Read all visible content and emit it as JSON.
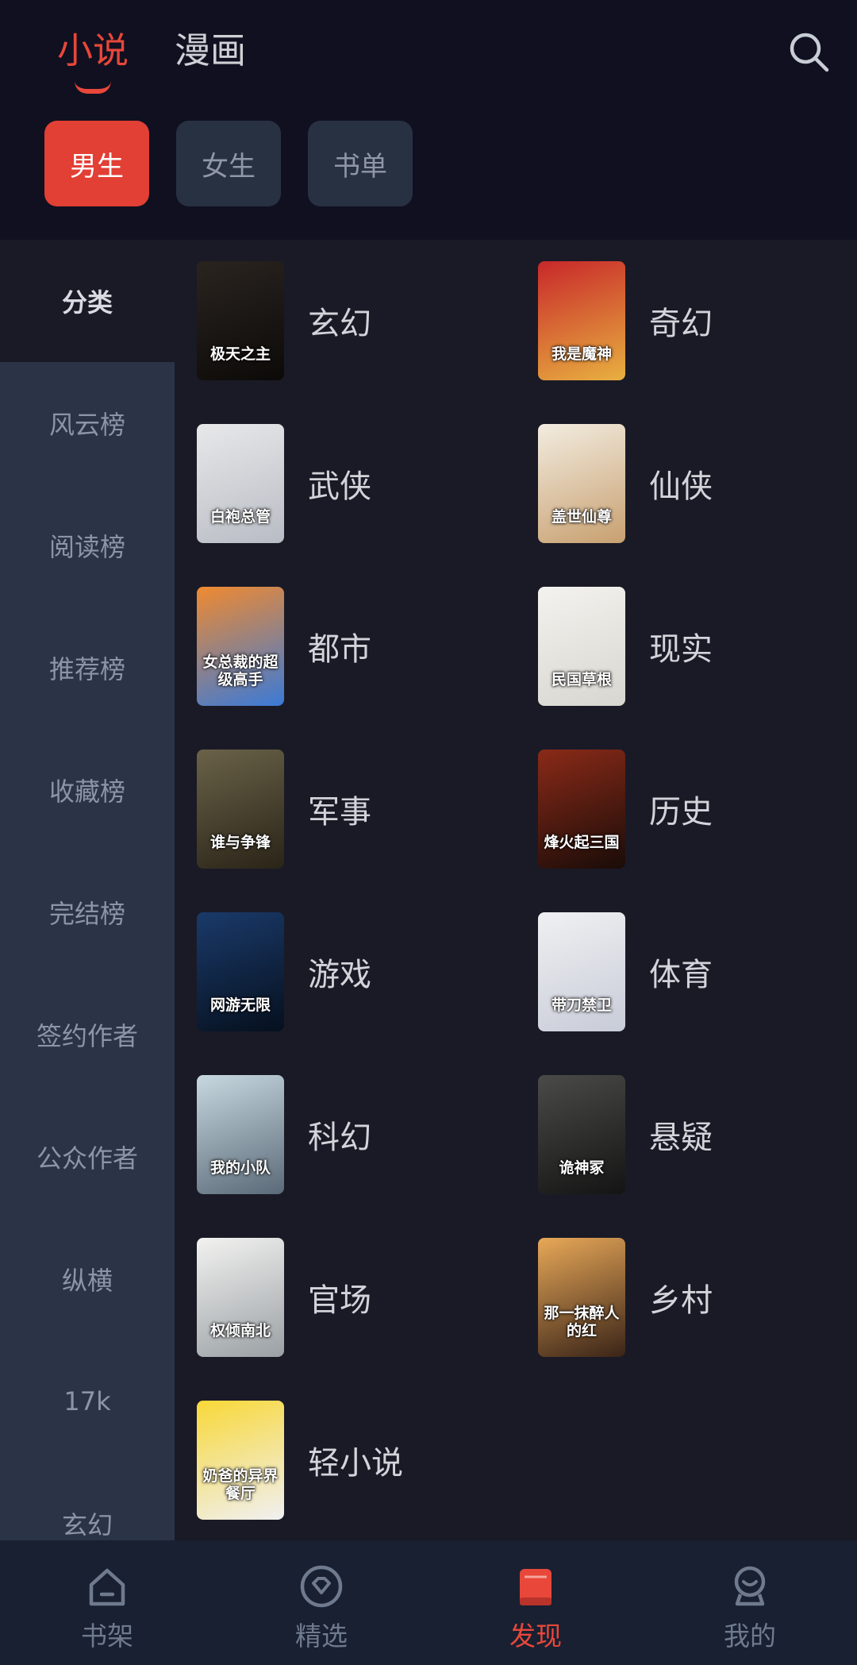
{
  "header": {
    "tabs": [
      {
        "label": "小说",
        "active": true
      },
      {
        "label": "漫画",
        "active": false
      }
    ],
    "search_icon": "search-icon",
    "gender_tabs": [
      {
        "label": "男生",
        "active": true
      },
      {
        "label": "女生",
        "active": false
      },
      {
        "label": "书单",
        "active": false
      }
    ]
  },
  "sidebar": {
    "items": [
      {
        "label": "分类",
        "active": true
      },
      {
        "label": "风云榜"
      },
      {
        "label": "阅读榜"
      },
      {
        "label": "推荐榜"
      },
      {
        "label": "收藏榜"
      },
      {
        "label": "完结榜"
      },
      {
        "label": "签约作者"
      },
      {
        "label": "公众作者"
      },
      {
        "label": "纵横"
      },
      {
        "label": "17k"
      },
      {
        "label": "玄幻"
      }
    ]
  },
  "categories": [
    {
      "label": "玄幻",
      "cover_title": "极天之主",
      "cover_colors": [
        "#2a2420",
        "#0c0a08"
      ]
    },
    {
      "label": "奇幻",
      "cover_title": "我是魔神",
      "cover_colors": [
        "#c8282a",
        "#e8b040"
      ]
    },
    {
      "label": "武侠",
      "cover_title": "白袍总管",
      "cover_colors": [
        "#e8e8ea",
        "#b8bcc4"
      ]
    },
    {
      "label": "仙侠",
      "cover_title": "盖世仙尊",
      "cover_colors": [
        "#f2ece0",
        "#c8a070"
      ]
    },
    {
      "label": "都市",
      "cover_title": "女总裁的超级高手",
      "cover_colors": [
        "#f08a30",
        "#3a7ad8"
      ]
    },
    {
      "label": "现实",
      "cover_title": "民国草根",
      "cover_colors": [
        "#f4f2ee",
        "#d8d6d0"
      ]
    },
    {
      "label": "军事",
      "cover_title": "谁与争锋",
      "cover_colors": [
        "#6a6248",
        "#2a2418"
      ]
    },
    {
      "label": "历史",
      "cover_title": "烽火起三国",
      "cover_colors": [
        "#8a2a18",
        "#1a0c08"
      ]
    },
    {
      "label": "游戏",
      "cover_title": "网游无限",
      "cover_colors": [
        "#1a3a6a",
        "#06101e"
      ]
    },
    {
      "label": "体育",
      "cover_title": "带刀禁卫",
      "cover_colors": [
        "#f0f0f2",
        "#c8ccd8"
      ]
    },
    {
      "label": "科幻",
      "cover_title": "我的小队",
      "cover_colors": [
        "#c8d8e0",
        "#5a6a78"
      ]
    },
    {
      "label": "悬疑",
      "cover_title": "诡神冢",
      "cover_colors": [
        "#4a4a48",
        "#141414"
      ]
    },
    {
      "label": "官场",
      "cover_title": "权倾南北",
      "cover_colors": [
        "#f2f2f0",
        "#9aa0a4"
      ]
    },
    {
      "label": "乡村",
      "cover_title": "那一抹醉人的红",
      "cover_colors": [
        "#e8a858",
        "#3a2418"
      ]
    },
    {
      "label": "轻小说",
      "cover_title": "奶爸的异界餐厅",
      "cover_colors": [
        "#f8d838",
        "#f0f0f2"
      ]
    }
  ],
  "bottom_nav": [
    {
      "label": "书架",
      "icon": "home-icon",
      "active": false
    },
    {
      "label": "精选",
      "icon": "diamond-icon",
      "active": false
    },
    {
      "label": "发现",
      "icon": "book-icon",
      "active": true
    },
    {
      "label": "我的",
      "icon": "profile-icon",
      "active": false
    }
  ],
  "colors": {
    "accent": "#e8473a",
    "header_bg": "#101020",
    "content_bg": "#1a1a26",
    "sidebar_bg": "#2b3447",
    "nav_bg": "#182031"
  }
}
